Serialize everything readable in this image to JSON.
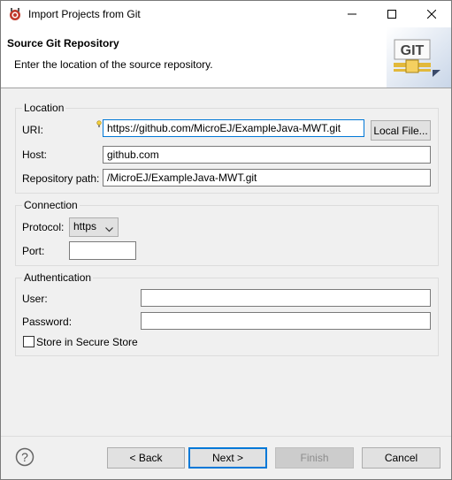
{
  "window": {
    "title": "Import Projects from Git"
  },
  "banner": {
    "title": "Source Git Repository",
    "description": "Enter the location of the source repository.",
    "logo_text": "GIT"
  },
  "location": {
    "group_label": "Location",
    "uri_label": "URI:",
    "uri_value": "https://github.com/MicroEJ/ExampleJava-MWT.git",
    "local_file_button": "Local File...",
    "host_label": "Host:",
    "host_value": "github.com",
    "repo_path_label": "Repository path:",
    "repo_path_value": "/MicroEJ/ExampleJava-MWT.git"
  },
  "connection": {
    "group_label": "Connection",
    "protocol_label": "Protocol:",
    "protocol_value": "https",
    "port_label": "Port:",
    "port_value": ""
  },
  "authentication": {
    "group_label": "Authentication",
    "user_label": "User:",
    "user_value": "",
    "password_label": "Password:",
    "password_value": "",
    "store_label": "Store in Secure Store",
    "store_checked": false
  },
  "footer": {
    "help_icon": "?",
    "back_label": "< Back",
    "next_label": "Next >",
    "finish_label": "Finish",
    "cancel_label": "Cancel"
  },
  "colors": {
    "accent": "#0078d7",
    "disabled_text": "#8d8d8d"
  }
}
